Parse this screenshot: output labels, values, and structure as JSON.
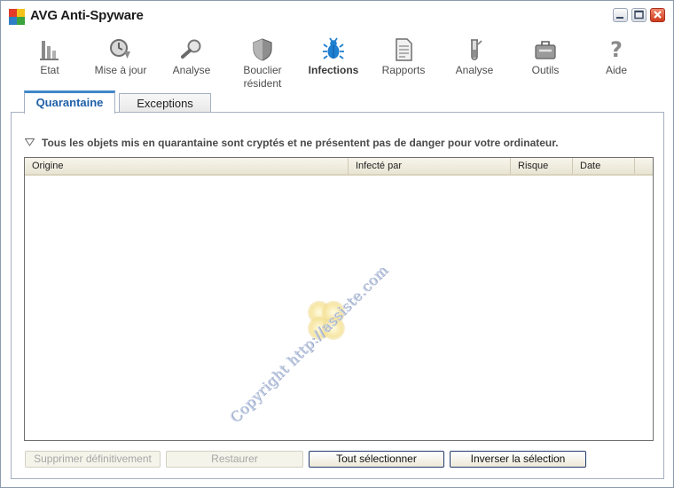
{
  "window": {
    "title": "AVG Anti-Spyware",
    "controls": [
      "minimize-icon",
      "maximize-icon",
      "close-icon"
    ]
  },
  "toolbar": {
    "items": [
      {
        "label": "Etat",
        "icon": "status-bars-icon"
      },
      {
        "label": "Mise à jour",
        "icon": "update-clock-icon"
      },
      {
        "label": "Analyse",
        "icon": "magnifier-icon"
      },
      {
        "label": "Bouclier\nrésident",
        "icon": "shield-icon"
      },
      {
        "label": "Infections",
        "icon": "bug-icon",
        "active": true
      },
      {
        "label": "Rapports",
        "icon": "report-document-icon"
      },
      {
        "label": "Analyse",
        "icon": "test-tube-icon"
      },
      {
        "label": "Outils",
        "icon": "toolbox-icon"
      },
      {
        "label": "Aide",
        "icon": "help-question-icon"
      }
    ]
  },
  "tabs": [
    {
      "label": "Quarantaine",
      "selected": true
    },
    {
      "label": "Exceptions",
      "selected": false
    }
  ],
  "panel": {
    "info_text": "Tous les objets mis en quarantaine sont cryptés et ne présentent pas de danger pour votre ordinateur.",
    "table": {
      "columns": [
        "Origine",
        "Infecté par",
        "Risque",
        "Date"
      ],
      "rows": []
    },
    "watermark": "Copyright http://assiste.com"
  },
  "buttons": {
    "delete": {
      "label": "Supprimer définitivement",
      "enabled": false
    },
    "restore": {
      "label": "Restaurer",
      "enabled": false
    },
    "select_all": {
      "label": "Tout sélectionner",
      "enabled": true
    },
    "invert": {
      "label": "Inverser la sélection",
      "enabled": true
    }
  },
  "colors": {
    "accent_tab": "#3f86c9",
    "tab_text": "#1f5fa8",
    "close_button": "#cf3a1c",
    "table_header": "#ece8d8"
  }
}
